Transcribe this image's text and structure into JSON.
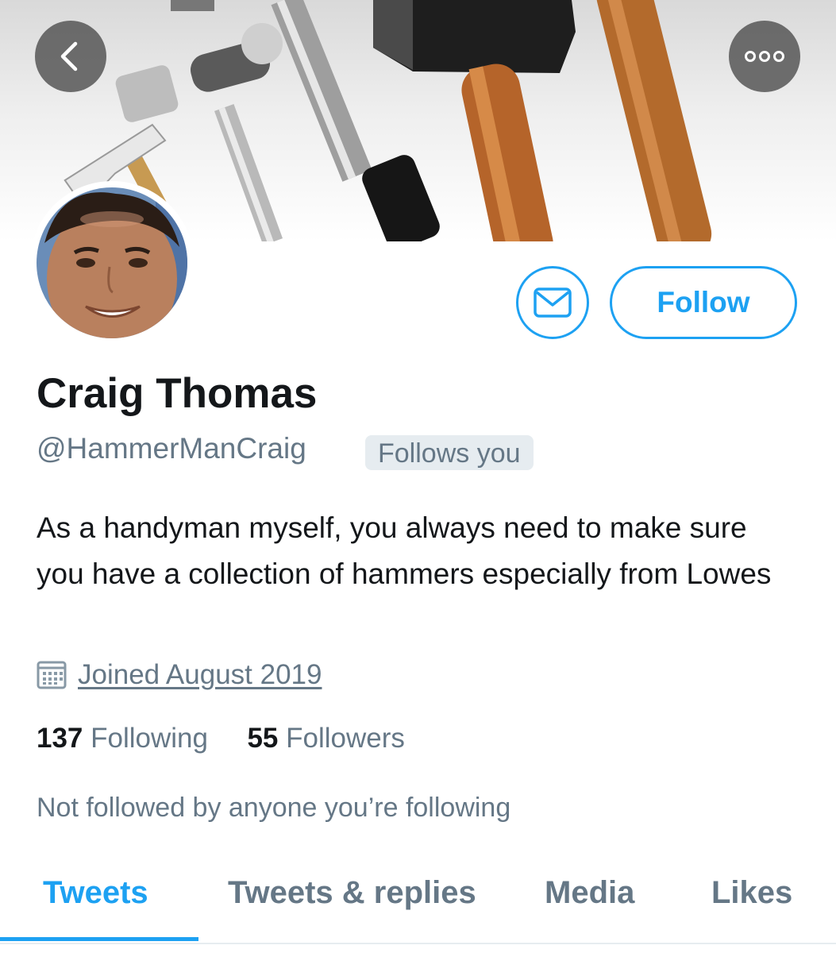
{
  "header": {
    "back_icon": "chevron-left-icon",
    "more_icon": "more-dots-icon",
    "banner": "hammers-banner-image"
  },
  "profile": {
    "name": "Craig Thomas",
    "handle": "@HammerManCraig",
    "follows_you_badge": "Follows you",
    "bio": "As a handyman myself, you always need to make sure you have a collection of hammers especially from Lowes",
    "joined": "Joined August 2019",
    "following_count": "137",
    "following_label": "Following",
    "followers_count": "55",
    "followers_label": "Followers",
    "mutuals_note": "Not followed by anyone you’re following"
  },
  "actions": {
    "message_icon": "envelope-icon",
    "follow_label": "Follow"
  },
  "tabs": [
    {
      "label": "Tweets",
      "active": true
    },
    {
      "label": "Tweets & replies",
      "active": false
    },
    {
      "label": "Media",
      "active": false
    },
    {
      "label": "Likes",
      "active": false
    }
  ],
  "colors": {
    "accent": "#1da1f2",
    "secondary_text": "#657786",
    "primary_text": "#14171a"
  }
}
